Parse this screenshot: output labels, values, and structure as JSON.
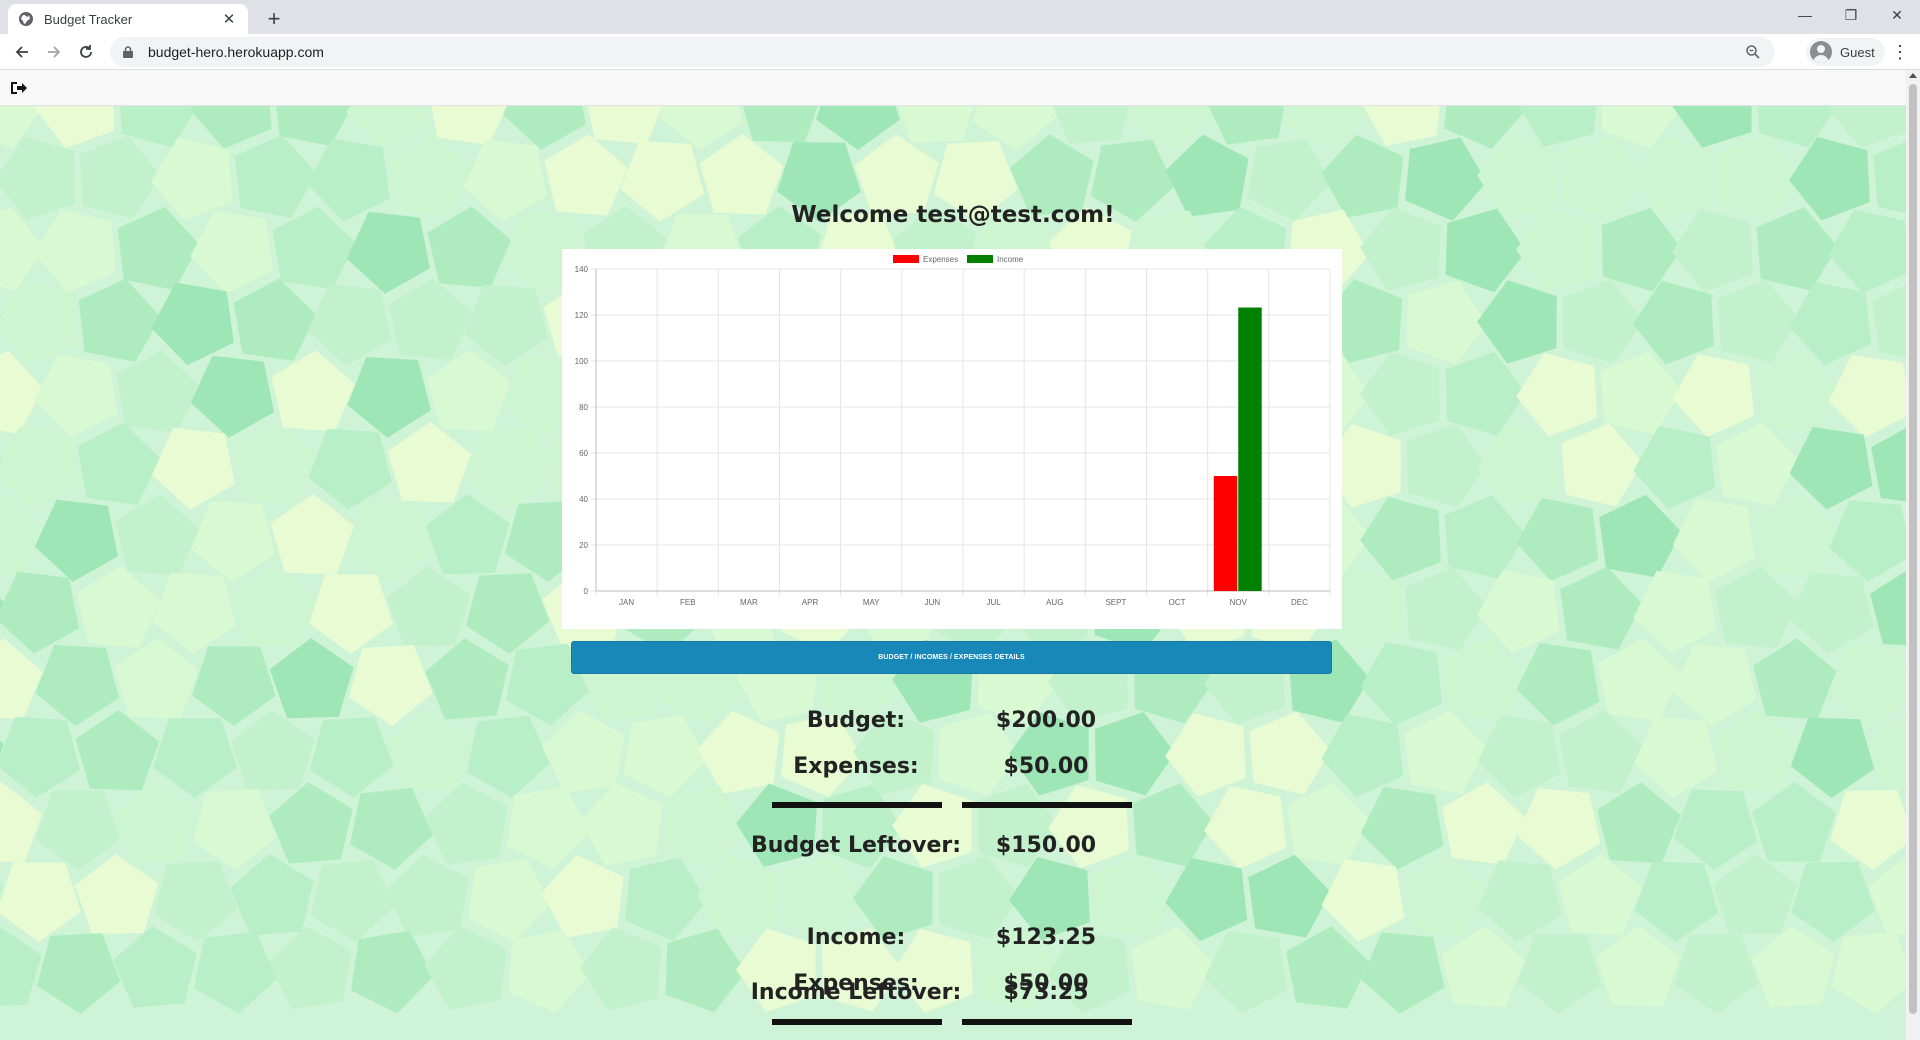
{
  "browser": {
    "tab_title": "Budget Tracker",
    "tab_close": "✕",
    "new_tab": "+",
    "url": "budget-hero.herokuapp.com",
    "profile_label": "Guest",
    "minimize": "—",
    "restore": "❐",
    "close": "✕",
    "menu": "⋮"
  },
  "page": {
    "welcome": "Welcome test@test.com!",
    "details_button": "BUDGET / INCOMES / EXPENSES DETAILS",
    "budget_section": {
      "budget_label": "Budget:",
      "budget_value": "$200.00",
      "expenses_label": "Expenses:",
      "expenses_value": "$50.00",
      "leftover_label": "Budget Leftover:",
      "leftover_value": "$150.00"
    },
    "income_section": {
      "income_label": "Income:",
      "income_value": "$123.25",
      "expenses_label": "Expenses:",
      "expenses_value": "$50.00",
      "leftover_label": "Income Leftover:",
      "leftover_value": "$73.25"
    }
  },
  "colors": {
    "expenses": "#ff0000",
    "income": "#008000",
    "button": "#1888b9"
  },
  "chart_data": {
    "type": "bar",
    "categories": [
      "JAN",
      "FEB",
      "MAR",
      "APR",
      "MAY",
      "JUN",
      "JUL",
      "AUG",
      "SEPT",
      "OCT",
      "NOV",
      "DEC"
    ],
    "series": [
      {
        "name": "Expenses",
        "color": "#ff0000",
        "values": [
          0,
          0,
          0,
          0,
          0,
          0,
          0,
          0,
          0,
          0,
          50,
          0
        ]
      },
      {
        "name": "Income",
        "color": "#008000",
        "values": [
          0,
          0,
          0,
          0,
          0,
          0,
          0,
          0,
          0,
          0,
          123.25,
          0
        ]
      }
    ],
    "yticks": [
      "0",
      "20",
      "40",
      "60",
      "80",
      "100",
      "120",
      "140"
    ],
    "ylim": [
      0,
      140
    ],
    "grid": true,
    "legend": "top-center"
  }
}
